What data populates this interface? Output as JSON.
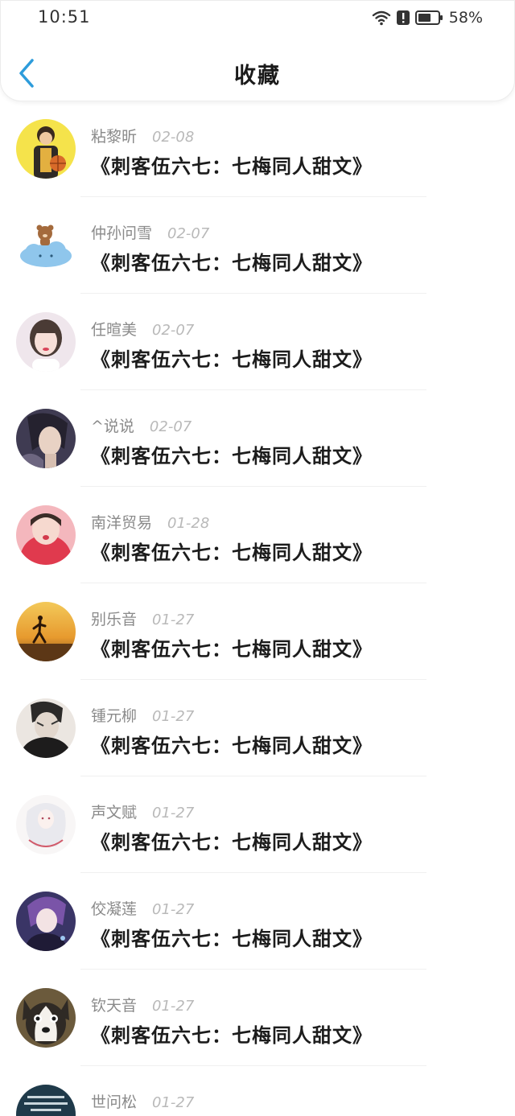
{
  "status_bar": {
    "time": "10:51",
    "battery": "58%",
    "icons": [
      "wifi-icon",
      "alert-icon",
      "battery-icon"
    ]
  },
  "nav": {
    "title": "收藏",
    "back_icon": "chevron-left-icon",
    "accent_color": "#2d9cdb"
  },
  "items": [
    {
      "user": "粘黎昕",
      "date": "02-08",
      "title": "《刺客伍六七：七梅同人甜文》",
      "avatar": "boy-basketball-avatar"
    },
    {
      "user": "仲孙问雪",
      "date": "02-07",
      "title": "《刺客伍六七：七梅同人甜文》",
      "avatar": "bear-cloud-avatar"
    },
    {
      "user": "任暄美",
      "date": "02-07",
      "title": "《刺客伍六七：七梅同人甜文》",
      "avatar": "girl-portrait-avatar"
    },
    {
      "user": "^说说",
      "date": "02-07",
      "title": "《刺客伍六七：七梅同人甜文》",
      "avatar": "anime-man-avatar"
    },
    {
      "user": "南洋贸易",
      "date": "01-28",
      "title": "《刺客伍六七：七梅同人甜文》",
      "avatar": "girl-red-hood-avatar"
    },
    {
      "user": "别乐音",
      "date": "01-27",
      "title": "《刺客伍六七：七梅同人甜文》",
      "avatar": "sunset-runner-avatar"
    },
    {
      "user": "锺元柳",
      "date": "01-27",
      "title": "《刺客伍六七：七梅同人甜文》",
      "avatar": "sketch-man-avatar"
    },
    {
      "user": "声文赋",
      "date": "01-27",
      "title": "《刺客伍六七：七梅同人甜文》",
      "avatar": "white-hair-avatar"
    },
    {
      "user": "佼凝莲",
      "date": "01-27",
      "title": "《刺客伍六七：七梅同人甜文》",
      "avatar": "purple-anime-avatar"
    },
    {
      "user": "钦天音",
      "date": "01-27",
      "title": "《刺客伍六七：七梅同人甜文》",
      "avatar": "husky-dog-avatar"
    },
    {
      "user": "世问松",
      "date": "01-27",
      "title": "",
      "avatar": "text-poster-avatar"
    }
  ]
}
